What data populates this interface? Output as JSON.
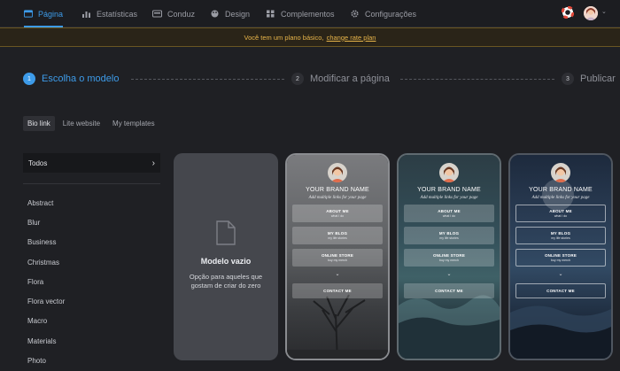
{
  "nav": {
    "items": [
      {
        "label": "Página",
        "icon": "page-icon",
        "active": true
      },
      {
        "label": "Estatísticas",
        "icon": "stats-icon",
        "active": false
      },
      {
        "label": "Conduz",
        "icon": "leads-icon",
        "active": false
      },
      {
        "label": "Design",
        "icon": "palette-icon",
        "active": false
      },
      {
        "label": "Complementos",
        "icon": "addons-icon",
        "active": false
      },
      {
        "label": "Configurações",
        "icon": "gear-icon",
        "active": false
      }
    ],
    "help_icon": "lifebuoy-icon",
    "account_icon": "avatar",
    "accent": "#3d9be9"
  },
  "banner": {
    "text": "Você tem um plano básico,",
    "link": "change rate plan",
    "color": "#e8b54a"
  },
  "steps": [
    {
      "num": "1",
      "label": "Escolha o modelo"
    },
    {
      "num": "2",
      "label": "Modificar a página"
    },
    {
      "num": "3",
      "label": "Publicar"
    }
  ],
  "tabs": [
    "Bio link",
    "Lite website",
    "My templates"
  ],
  "sidebar": {
    "all_label": "Todos",
    "categories": [
      "Abstract",
      "Blur",
      "Business",
      "Christmas",
      "Flora",
      "Flora vector",
      "Macro",
      "Materials",
      "Photo"
    ]
  },
  "empty_template": {
    "title": "Modelo vazio",
    "desc": "Opção para aqueles que gostam de criar do zero"
  },
  "templates": [
    {
      "brand": "YOUR BRAND NAME",
      "tagline": "Add multiple links for your page",
      "buttons": [
        {
          "title": "ABOUT ME",
          "sub": "what I do"
        },
        {
          "title": "MY BLOG",
          "sub": "my life stories"
        },
        {
          "title": "ONLINE STORE",
          "sub": "buy my merch"
        }
      ],
      "contact": "CONTACT ME"
    },
    {
      "brand": "YOUR BRAND NAME",
      "tagline": "Add multiple links for your page",
      "buttons": [
        {
          "title": "ABOUT ME",
          "sub": "what I do"
        },
        {
          "title": "MY BLOG",
          "sub": "my life stories"
        },
        {
          "title": "ONLINE STORE",
          "sub": "buy my merch"
        }
      ],
      "contact": "CONTACT ME"
    },
    {
      "brand": "YOUR BRAND NAME",
      "tagline": "Add multiple links for your page",
      "buttons": [
        {
          "title": "ABOUT ME",
          "sub": "what I do"
        },
        {
          "title": "MY BLOG",
          "sub": "my life stories"
        },
        {
          "title": "ONLINE STORE",
          "sub": "buy my merch"
        }
      ],
      "contact": "CONTACT ME"
    }
  ]
}
